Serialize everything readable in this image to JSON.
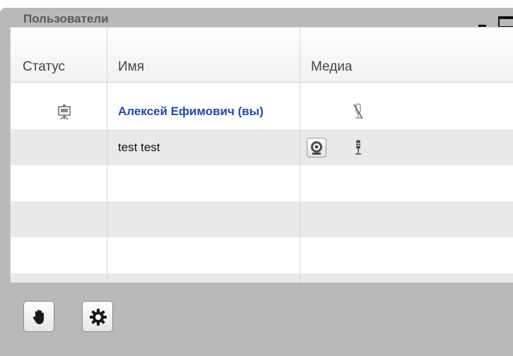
{
  "panel": {
    "title": "Пользователи",
    "minimize_icon": "minimize-icon",
    "maximize_icon": "maximize-icon"
  },
  "grid": {
    "columns": [
      "Статус",
      "Имя",
      "Медиа"
    ],
    "rows": [
      {
        "status_icon": "presenter-icon",
        "name": "Алексей Ефимович (вы)",
        "role": "presenter",
        "media": [
          "mic-muted-icon"
        ]
      },
      {
        "status_icon": "",
        "name": "test test",
        "role": "viewer",
        "media": [
          "webcam-icon",
          "mic-icon"
        ]
      }
    ],
    "empty_rows": 3
  },
  "footer": {
    "buttons": [
      "raise-hand-icon",
      "settings-gear-icon"
    ]
  },
  "colors": {
    "panel_bg": "#b9b9b9",
    "presenter_name": "#1f48b4",
    "alt_row": "#e9e9eb"
  }
}
